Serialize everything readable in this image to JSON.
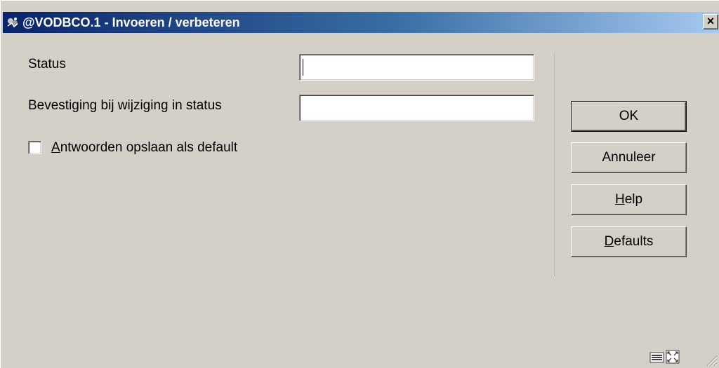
{
  "window": {
    "title": "@VODBCO.1 - Invoeren / verbeteren",
    "close_symbol": "×",
    "icon": "app-icon"
  },
  "form": {
    "status_label": "Status",
    "status_value": "",
    "confirm_label": "Bevestiging bij wijziging in status",
    "confirm_value": "",
    "save_default": {
      "accel": "A",
      "rest": "ntwoorden opslaan als default",
      "checked": false
    }
  },
  "buttons": {
    "ok": "OK",
    "cancel": "Annuleer",
    "help": {
      "accel": "H",
      "rest": "elp"
    },
    "defaults": {
      "accel": "D",
      "rest": "efaults"
    }
  },
  "statusbar": {
    "icons": [
      "keyboard-icon",
      "fullscreen-icon",
      "resize-grip-icon"
    ]
  },
  "colors": {
    "title_start": "#0a246a",
    "title_end": "#a6caf0",
    "face": "#d4d0c8"
  }
}
